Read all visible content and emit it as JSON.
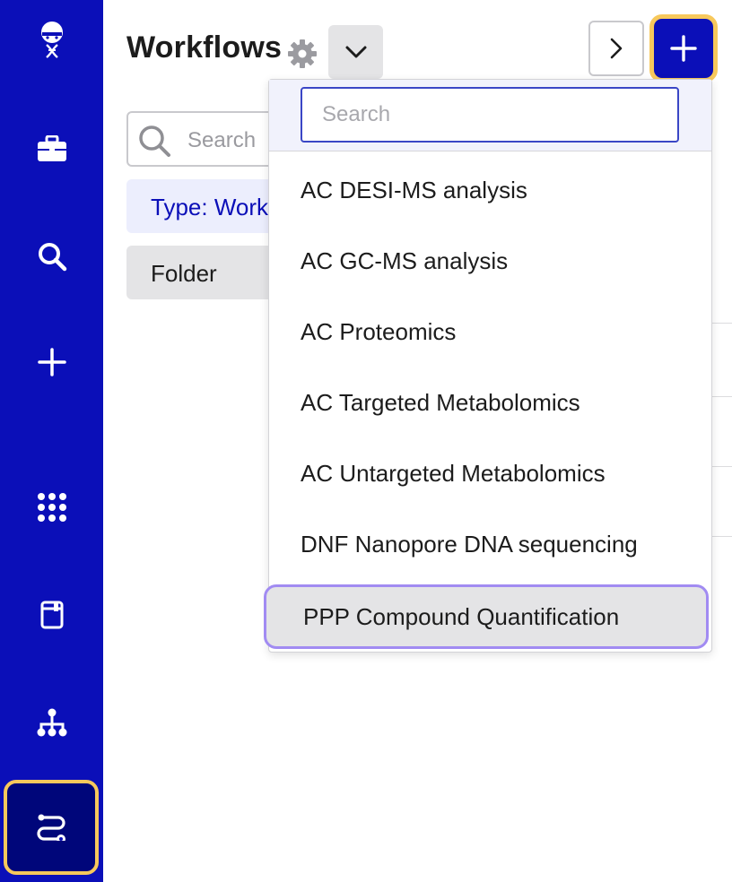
{
  "sidebar": {
    "items": [
      {
        "name": "logo",
        "icon": "dna-astronaut-icon"
      },
      {
        "name": "projects",
        "icon": "briefcase-icon"
      },
      {
        "name": "search",
        "icon": "search-icon"
      },
      {
        "name": "create",
        "icon": "plus-icon"
      },
      {
        "name": "apps",
        "icon": "grid-dots-icon"
      },
      {
        "name": "notebook",
        "icon": "notebook-icon"
      },
      {
        "name": "hierarchy",
        "icon": "hierarchy-icon"
      },
      {
        "name": "workflows",
        "icon": "workflow-icon",
        "active": true
      }
    ],
    "colors": {
      "background": "#0b0fb8",
      "active": "#00067a",
      "highlight": "#f7c85c"
    }
  },
  "header": {
    "title": "Workflows"
  },
  "filters": {
    "search_placeholder": "Search",
    "type_chip": "Type: Work",
    "folder_label": "Folder"
  },
  "dropdown": {
    "search_placeholder": "Search",
    "items": [
      "AC DESI-MS analysis",
      "AC GC-MS analysis",
      "AC Proteomics",
      "AC Targeted Metabolomics",
      "AC Untargeted Metabolomics",
      "DNF Nanopore DNA sequencing",
      "PPP Compound Quantification"
    ],
    "active_index": 6
  }
}
